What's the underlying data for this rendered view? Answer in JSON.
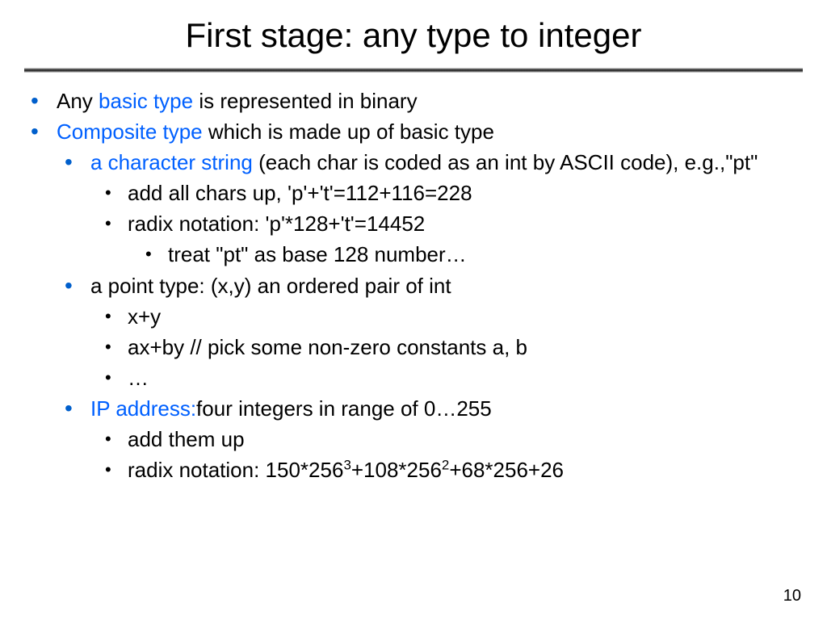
{
  "title": "First stage: any type to integer",
  "bullets": {
    "b1_pre": "Any ",
    "b1_hl": "basic type",
    "b1_post": " is represented in binary",
    "b2_hl": "Composite type",
    "b2_post": " which is made up of basic type",
    "b3_hl": "a character string",
    "b3_post": " (each char is coded as an int by ASCII code), e.g.,\"pt\"",
    "b4": "add all chars up, 'p'+'t'=112+116=228",
    "b5": "radix notation: 'p'*128+'t'=14452",
    "b6": "treat \"pt\" as base 128 number…",
    "b7": "a point type: (x,y) an ordered pair of int",
    "b8": "x+y",
    "b9": "ax+by // pick some non-zero constants a, b",
    "b10": "…",
    "b11_hl": "IP address:",
    "b11_post": "four integers in range of 0…255",
    "b12": "add them up",
    "b13_pre": "radix notation: 150*256",
    "b13_sup1": "3",
    "b13_mid": "+108*256",
    "b13_sup2": "2",
    "b13_post": "+68*256+26"
  },
  "page_number": "10"
}
